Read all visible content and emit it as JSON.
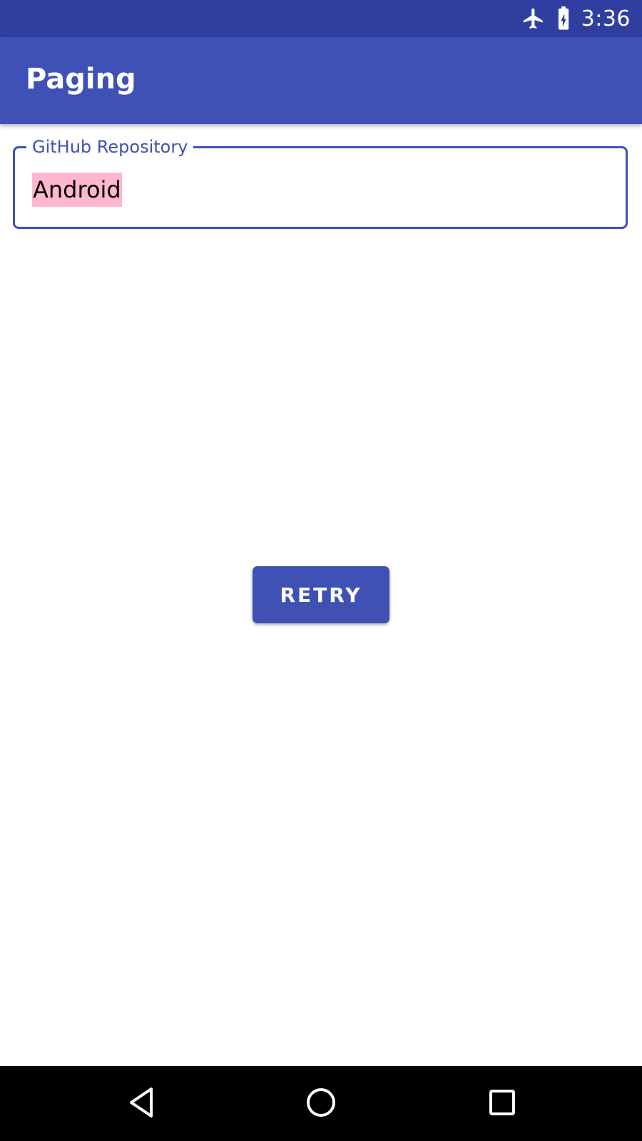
{
  "status_bar": {
    "time": "3:36",
    "icons": [
      "airplane-mode-icon",
      "battery-charging-icon"
    ]
  },
  "app_bar": {
    "title": "Paging"
  },
  "search_field": {
    "label": "GitHub Repository",
    "value": "Android"
  },
  "retry_button": {
    "label": "RETRY"
  },
  "nav_bar": {
    "icons": [
      "back-icon",
      "home-icon",
      "recents-icon"
    ]
  },
  "colors": {
    "primary": "#3f51b5",
    "primary_dark": "#303f9f",
    "selection_highlight": "#ffb7ce"
  }
}
